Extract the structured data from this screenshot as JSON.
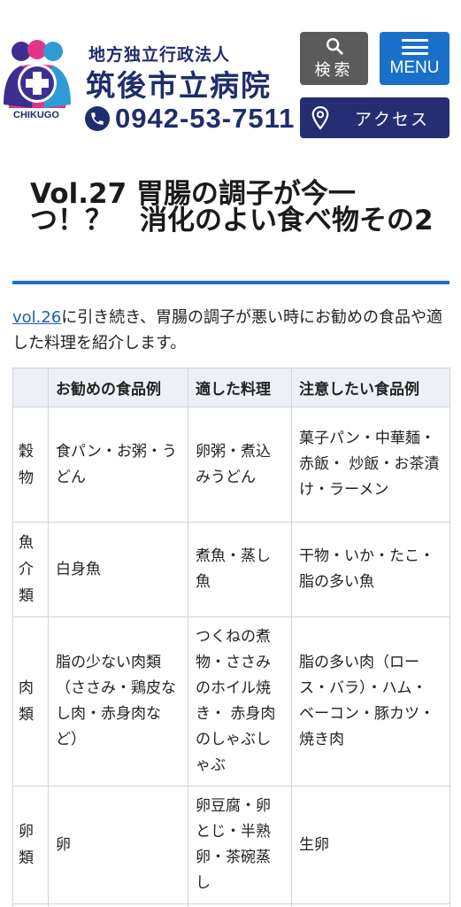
{
  "header": {
    "logo_text": "CHIKUGO",
    "org_type": "地方独立行政法人",
    "hospital_name": "筑後市立病院",
    "phone": "0942-53-7511",
    "search_label": "検索",
    "menu_label": "MENU",
    "access_label": "アクセス",
    "icons": {
      "search": "search-icon",
      "menu": "hamburger-icon",
      "access": "map-pin-icon",
      "phone": "phone-icon"
    },
    "colors": {
      "brand_navy": "#1e2d6b",
      "menu_blue": "#1a70c9",
      "search_gray": "#5b5b5b",
      "access_navy": "#252d75"
    }
  },
  "article": {
    "title": "Vol.27 胃腸の調子が今一つ！？　消化のよい食べ物その2",
    "intro_link": "vol.26",
    "intro_text": "に引き続き、胃腸の調子が悪い時にお勧めの食品や適した料理を紹介します。"
  },
  "table": {
    "headers": [
      "",
      "お勧めの食品例",
      "適した料理",
      "注意したい食品例"
    ],
    "rows": [
      {
        "category": "穀物",
        "recommended": "食パン・お粥・うどん",
        "dishes": "卵粥・煮込みうどん",
        "caution": "菓子パン・中華麺・赤飯・ 炒飯・お茶漬け・ラーメン"
      },
      {
        "category": "魚介類",
        "recommended": "白身魚",
        "dishes": "煮魚・蒸し魚",
        "caution": "干物・いか・たこ・脂の多い魚"
      },
      {
        "category": "肉類",
        "recommended": "脂の少ない肉類（ささみ・鶏皮なし肉・赤身肉など）",
        "dishes": "つくねの煮物・ささみのホイル焼き・ 赤身肉のしゃぶしゃぶ",
        "caution": "脂の多い肉（ロース・バラ）・ハム・ ベーコン・豚カツ・焼き肉"
      },
      {
        "category": "卵類",
        "recommended": "卵",
        "dishes": "卵豆腐・卵とじ・半熟卵・茶碗蒸し",
        "caution": "生卵"
      },
      {
        "category": "",
        "recommended": "",
        "dishes": "",
        "caution": ""
      }
    ]
  }
}
